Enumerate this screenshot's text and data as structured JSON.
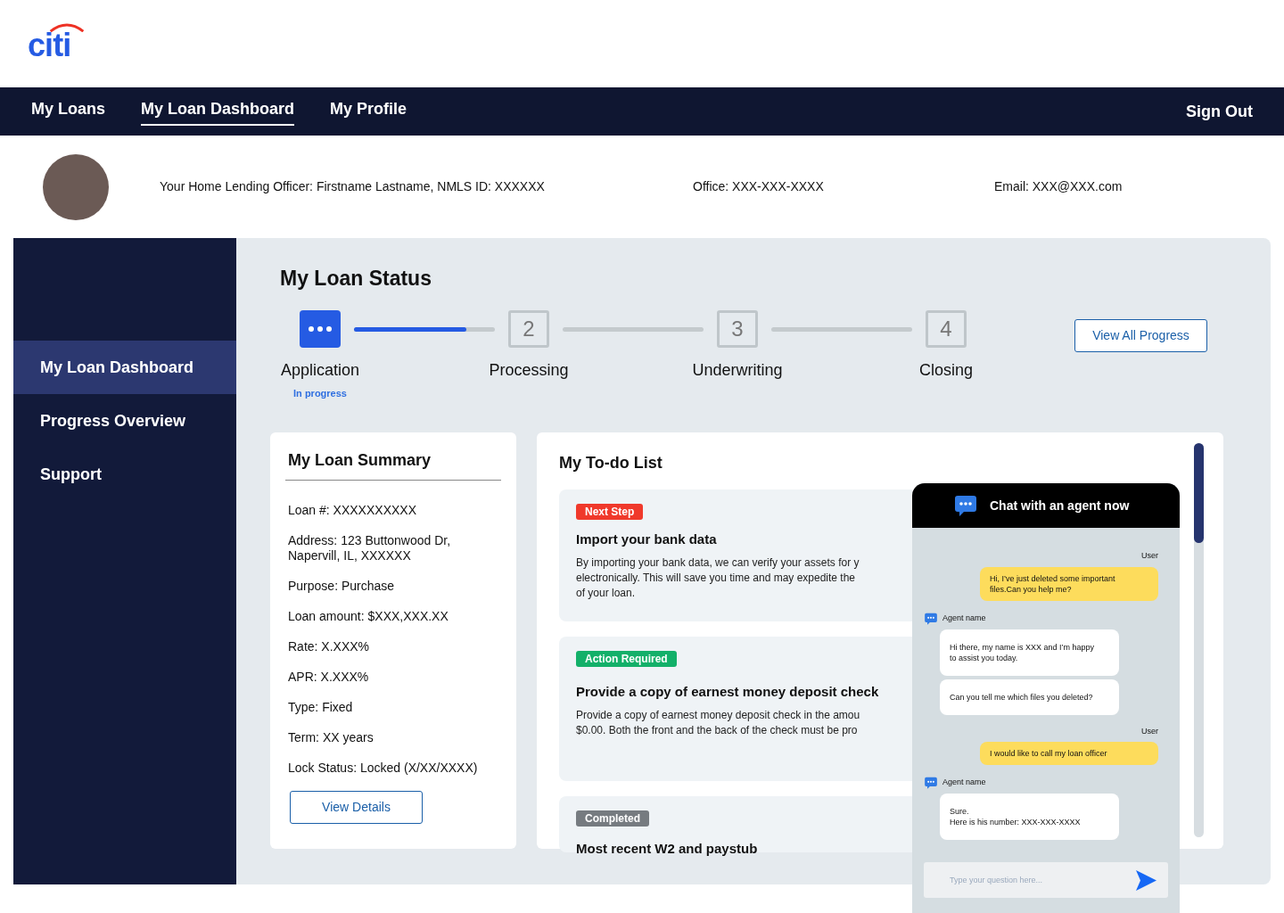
{
  "logo": "citi",
  "nav": {
    "items": [
      {
        "label": "My Loans",
        "selected": false
      },
      {
        "label": "My Loan Dashboard",
        "selected": true
      },
      {
        "label": "My Profile",
        "selected": false
      }
    ],
    "sign_out": "Sign Out"
  },
  "officer": {
    "name_line": "Your Home Lending Officer: Firstname Lastname, NMLS ID: XXXXXX",
    "office": "Office: XXX-XXX-XXXX",
    "email": "Email: XXX@XXX.com"
  },
  "sidebar": {
    "items": [
      {
        "label": "My Loan Dashboard",
        "selected": true
      },
      {
        "label": "Progress Overview",
        "selected": false
      },
      {
        "label": "Support",
        "selected": false
      }
    ]
  },
  "loan_status": {
    "title": "My Loan Status",
    "view_all": "View All Progress",
    "steps": [
      {
        "kind": "current",
        "label": "Application",
        "status": "In progress",
        "level": 0.8
      },
      {
        "kind": "pending",
        "number": "2",
        "label": "Processing",
        "level": 0
      },
      {
        "kind": "pending",
        "number": "3",
        "label": "Underwriting",
        "level": 0
      },
      {
        "kind": "pending",
        "number": "4",
        "label": "Closing"
      }
    ]
  },
  "summary": {
    "title": "My Loan Summary",
    "rows": [
      [
        "Loan #: XXXXXXXXXX"
      ],
      [
        "Address: 123 Buttonwood Dr,",
        "Napervill, IL, XXXXXX"
      ],
      [
        "Purpose: Purchase"
      ],
      [
        "Loan amount: $XXX,XXX.XX"
      ],
      [
        "Rate: X.XXX%"
      ],
      [
        "APR: X.XXX%"
      ],
      [
        "Type: Fixed"
      ],
      [
        "Term: XX years"
      ],
      [
        "Lock Status: Locked (X/XX/XXXX)"
      ]
    ],
    "button": "View Details"
  },
  "todo": {
    "title": "My To-do List",
    "items": [
      {
        "tag": "Next Step",
        "color": "#f0392b",
        "title": "Import your bank data",
        "lines": [
          "By importing your bank data, we can verify your assets for y",
          "electronically. This will save you time and may expedite the",
          "of your loan."
        ]
      },
      {
        "tag": "Action Required",
        "color": "#13b069",
        "title": "Provide a copy of earnest money deposit check",
        "lines": [
          "Provide a copy of earnest money deposit check in the amou",
          "$0.00. Both the front and the back of the check must be pro"
        ]
      },
      {
        "tag": "Completed",
        "color": "#767b80",
        "title": "Most recent W2 and paystub"
      }
    ]
  },
  "chat": {
    "title": "Chat with an agent now",
    "messages": [
      {
        "kind": "user",
        "sender": "User",
        "texts": [
          [
            "Hi, I’ve just deleted some important",
            "files.Can you help me?"
          ]
        ]
      },
      {
        "kind": "agent",
        "sender": "Agent name",
        "texts": [
          [
            "Hi there, my name is XXX and I’m happy",
            "to assist you today."
          ],
          [
            "Can you tell me which files you deleted?"
          ]
        ]
      },
      {
        "kind": "user",
        "sender": "User",
        "texts": [
          [
            "I would like to call my loan officer"
          ]
        ]
      },
      {
        "kind": "agent",
        "sender": "Agent name",
        "texts": [
          [
            "Sure.",
            "Here is his number: XXX-XXX-XXXX"
          ]
        ]
      }
    ],
    "placeholder": "Type your question here..."
  }
}
